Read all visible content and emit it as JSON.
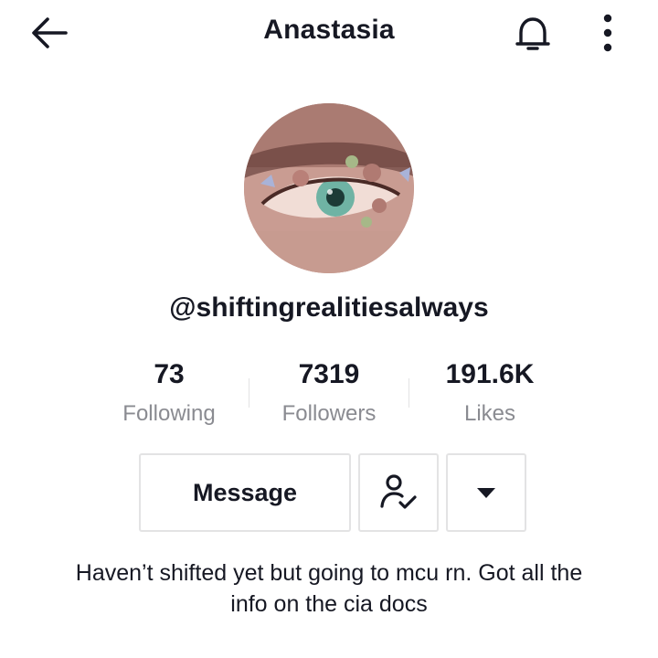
{
  "header": {
    "title": "Anastasia",
    "back_icon": "arrow-left-icon",
    "bell_icon": "bell-icon",
    "more_icon": "more-vertical-icon"
  },
  "profile": {
    "avatar": "avatar-eye-with-flowers",
    "username": "@shiftingrealitiesalways",
    "bio": "Haven’t shifted yet but going to mcu rn. Got all the info on the cia docs"
  },
  "stats": [
    {
      "value": "73",
      "label": "Following"
    },
    {
      "value": "7319",
      "label": "Followers"
    },
    {
      "value": "191.6K",
      "label": "Likes"
    }
  ],
  "actions": {
    "message_label": "Message",
    "follow_icon": "user-check-icon",
    "dropdown_icon": "caret-down-icon"
  },
  "colors": {
    "text": "#161823",
    "secondary_text": "#8a8b91",
    "border": "#e3e3e4",
    "background": "#ffffff"
  }
}
